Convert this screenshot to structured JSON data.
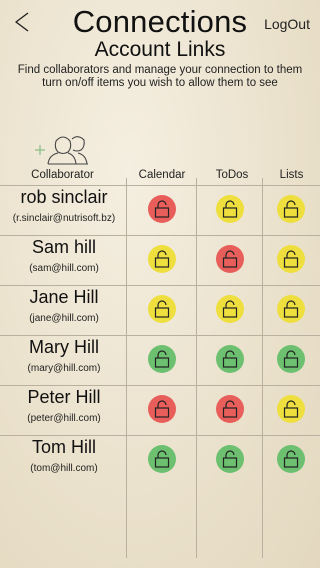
{
  "header": {
    "title": "Connections",
    "subtitle": "Account Links",
    "logout_label": "LogOut",
    "instructions_line1": "Find collaborators and manage your connection to them",
    "instructions_line2": "turn on/off items you wish to allow them to see"
  },
  "columns": {
    "collaborator": "Collaborator",
    "calendar": "Calendar",
    "todos": "ToDos",
    "lists": "Lists"
  },
  "icons": {
    "back": "back-arrow-icon",
    "add_collaborator": "add-people-icon",
    "lock": "padlock-icon"
  },
  "colors": {
    "red": "#e85e5a",
    "yellow": "#eedf3f",
    "green": "#6cc070"
  },
  "rows": [
    {
      "name": "rob sinclair",
      "email": "(r.sinclair@nutrisoft.bz)",
      "calendar": "red",
      "todos": "yellow",
      "lists": "yellow"
    },
    {
      "name": "Sam hill",
      "email": "(sam@hill.com)",
      "calendar": "yellow",
      "todos": "red",
      "lists": "yellow"
    },
    {
      "name": "Jane Hill",
      "email": "(jane@hill.com)",
      "calendar": "yellow",
      "todos": "yellow",
      "lists": "yellow"
    },
    {
      "name": "Mary Hill",
      "email": "(mary@hill.com)",
      "calendar": "green",
      "todos": "green",
      "lists": "green"
    },
    {
      "name": "Peter Hill",
      "email": "(peter@hill.com)",
      "calendar": "red",
      "todos": "red",
      "lists": "yellow"
    },
    {
      "name": "Tom Hill",
      "email": "(tom@hill.com)",
      "calendar": "green",
      "todos": "green",
      "lists": "green"
    }
  ]
}
